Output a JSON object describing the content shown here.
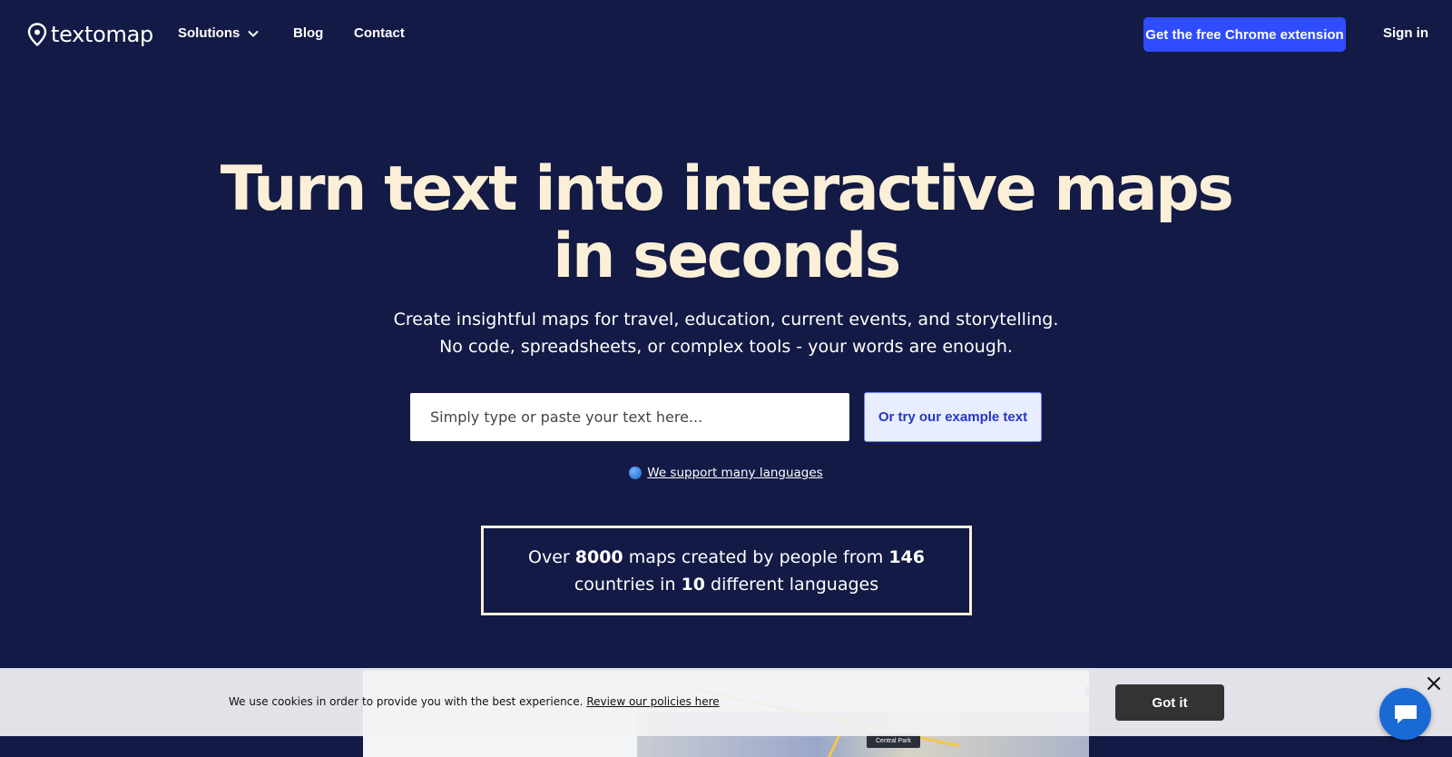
{
  "nav": {
    "logo_text": "textomap",
    "links": [
      "Solutions",
      "Blog",
      "Contact"
    ],
    "cta_label": "Get the free Chrome extension",
    "signin_label": "Sign in"
  },
  "hero": {
    "title_line1": "Turn text into interactive maps",
    "title_line2": "in seconds",
    "subtitle_line1": "Create insightful maps for travel, education, current events, and storytelling.",
    "subtitle_line2": "No code, spreadsheets, or complex tools - your words are enough.",
    "input_placeholder": "Simply type or paste your text here...",
    "example_button": "Or try our example text",
    "languages_link": "We support many languages"
  },
  "stats": {
    "prefix": "Over",
    "maps": "8000",
    "mid": "maps created by people from",
    "countries": "146",
    "line2_prefix": "countries in",
    "languages": "10",
    "suffix": "different languages"
  },
  "preview": {
    "tag_label": "Central Park"
  },
  "cookie": {
    "text": "We use cookies in order to provide you with the best experience.",
    "link": "Review our policies here",
    "button": "Got it"
  },
  "colors": {
    "background": "#131a45",
    "title": "#fbf0d7",
    "cta": "#2f4cff",
    "chat": "#1a6ad6"
  }
}
